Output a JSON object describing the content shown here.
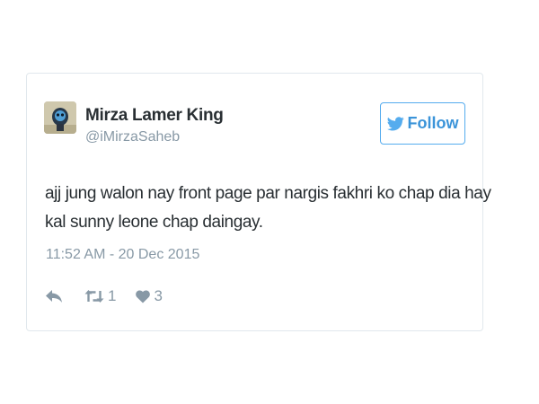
{
  "tweet": {
    "author_name": "Mirza Lamer King",
    "author_handle": "@iMirzaSaheb",
    "follow_label": "Follow",
    "text_lines": [
      "ajj jung walon nay front page par nargis fakhri ko chap dia hay",
      "kal sunny leone chap daingay."
    ],
    "timestamp": "11:52 AM - 20 Dec 2015",
    "retweet_count": "1",
    "like_count": "3"
  },
  "icons": {
    "follow": "twitter-bird-icon",
    "reply": "reply-icon",
    "retweet": "retweet-icon",
    "like": "heart-icon"
  },
  "colors": {
    "accent": "#55acee",
    "text": "#292f33",
    "muted": "#8899a6",
    "border": "#e1e8ed"
  }
}
